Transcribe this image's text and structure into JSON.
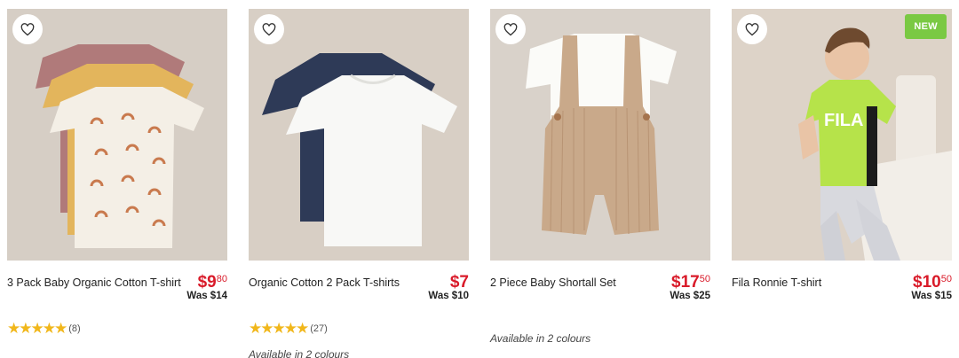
{
  "products": [
    {
      "name": "3 Pack Baby Organic Cotton T-shirt",
      "price_dollars": "$9",
      "price_cents": "80",
      "was": "Was $14",
      "rating_count": "(8)",
      "rating": 5,
      "colours": "",
      "image_bg": "#d6cec5"
    },
    {
      "name": "Organic Cotton 2 Pack T-shirts",
      "price_dollars": "$7",
      "price_cents": "",
      "was": "Was $10",
      "rating_count": "(27)",
      "rating": 5,
      "colours": "Available in 2 colours",
      "image_bg": "#d8cfc5"
    },
    {
      "name": "2 Piece Baby Shortall Set",
      "price_dollars": "$17",
      "price_cents": "50",
      "was": "Was $25",
      "rating_count": "",
      "colours": "Available in 2 colours",
      "image_bg": "#d9d2ca"
    },
    {
      "name": "Fila Ronnie T-shirt",
      "price_dollars": "$10",
      "price_cents": "50",
      "was": "Was $15",
      "rating_count": "",
      "colours": "",
      "badge": "NEW",
      "image_bg": "#ddd3c8"
    }
  ],
  "icons": {
    "wishlist": "heart-outline-icon",
    "star": "star-icon"
  },
  "colors": {
    "price": "#d91b2a",
    "star": "#f1b71b",
    "badge": "#7ac943"
  }
}
